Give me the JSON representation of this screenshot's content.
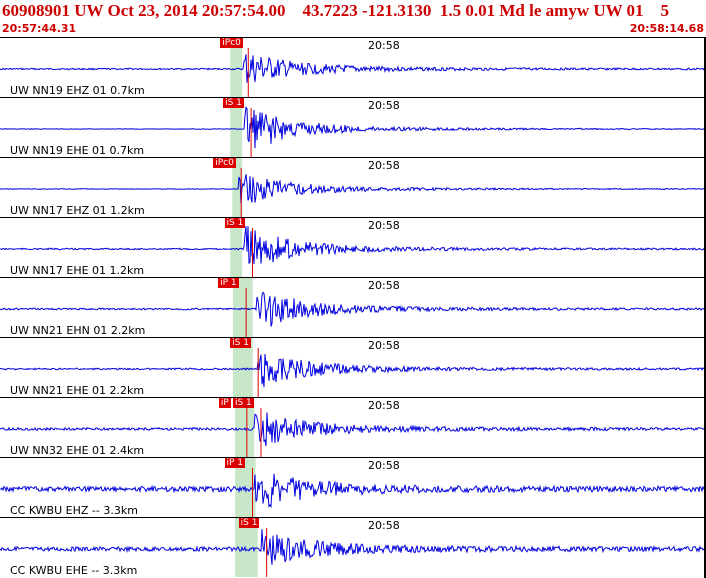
{
  "header": {
    "title": "60908901 UW Oct 23, 2014 20:57:54.00    43.7223 -121.3130  1.5 0.01 Md le amyw UW 01    5",
    "time_start": "20:57:44.31",
    "time_end": "20:58:14.68"
  },
  "colors": {
    "trace": "#0000dd",
    "pick": "#dd0000",
    "header_text": "#cc0000",
    "window_shade": "#c8e6c8"
  },
  "panels": [
    {
      "station": "UW NN19 EHZ 01 0.7km",
      "tick_label": "20:58",
      "picks": [
        {
          "label": "iPc0",
          "pos": 0.312
        }
      ],
      "shade": [
        0.326,
        0.343
      ],
      "amp": 0.55,
      "onset": 0.345,
      "noise": 0.05
    },
    {
      "station": "UW NN19 EHE 01 0.7km",
      "tick_label": "20:58",
      "picks": [
        {
          "label": "iS 1",
          "pos": 0.316
        }
      ],
      "shade": [
        0.326,
        0.343
      ],
      "amp": 0.8,
      "onset": 0.347,
      "noise": 0.02
    },
    {
      "station": "UW NN17 EHZ 01 1.2km",
      "tick_label": "20:58",
      "picks": [
        {
          "label": "iPc0",
          "pos": 0.302
        }
      ],
      "shade": [
        0.329,
        0.343
      ],
      "amp": 0.55,
      "onset": 0.338,
      "noise": 0.02
    },
    {
      "station": "UW NN17 EHE 01 1.2km",
      "tick_label": "20:58",
      "picks": [
        {
          "label": "iS 1",
          "pos": 0.318
        }
      ],
      "shade": [
        0.326,
        0.343
      ],
      "amp": 0.75,
      "onset": 0.345,
      "noise": 0.05
    },
    {
      "station": "UW NN21 EHN 01 2.2km",
      "tick_label": "20:58",
      "picks": [
        {
          "label": "iP 1",
          "pos": 0.309
        }
      ],
      "shade": [
        0.33,
        0.358
      ],
      "amp": 0.7,
      "onset": 0.363,
      "noise": 0.06
    },
    {
      "station": "UW NN21 EHE 01 2.2km",
      "tick_label": "20:58",
      "picks": [
        {
          "label": "iS 1",
          "pos": 0.326
        }
      ],
      "shade": [
        0.33,
        0.358
      ],
      "amp": 0.6,
      "onset": 0.365,
      "noise": 0.06
    },
    {
      "station": "UW NN32 EHE 01 2.4km",
      "tick_label": "20:58",
      "picks": [
        {
          "label": "iP",
          "pos": 0.31
        },
        {
          "label": "iS 1",
          "pos": 0.33
        }
      ],
      "shade": [
        0.333,
        0.36
      ],
      "amp": 0.6,
      "onset": 0.36,
      "noise": 0.09
    },
    {
      "station": "CC KWBU EHZ -- 3.3km",
      "tick_label": "20:58",
      "picks": [
        {
          "label": "iP 1",
          "pos": 0.318
        }
      ],
      "shade": [
        0.333,
        0.362
      ],
      "amp": 0.65,
      "onset": 0.36,
      "noise": 0.18
    },
    {
      "station": "CC KWBU EHE -- 3.3km",
      "tick_label": "20:58",
      "picks": [
        {
          "label": "iS 1",
          "pos": 0.338
        }
      ],
      "shade": [
        0.333,
        0.365
      ],
      "amp": 0.55,
      "onset": 0.37,
      "noise": 0.15
    }
  ]
}
